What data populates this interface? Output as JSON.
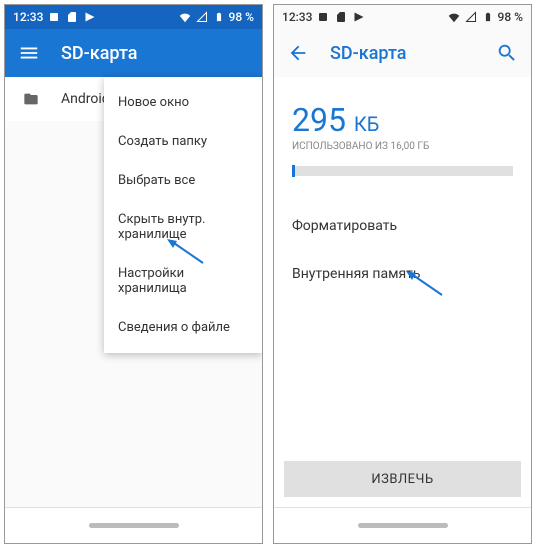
{
  "left": {
    "status": {
      "time": "12:33",
      "battery": "98 %"
    },
    "appbar": {
      "title": "SD-карта"
    },
    "folder": {
      "name": "Android"
    },
    "menu": {
      "items": [
        "Новое окно",
        "Создать папку",
        "Выбрать все",
        "Скрыть внутр. хранилище",
        "Настройки хранилища",
        "Сведения о файле"
      ]
    }
  },
  "right": {
    "status": {
      "time": "12:33",
      "battery": "98 %"
    },
    "appbar": {
      "title": "SD-карта"
    },
    "storage": {
      "value": "295",
      "unit": "КБ",
      "caption": "использовано из 16,00 ГБ"
    },
    "options": {
      "format": "Форматировать",
      "internal": "Внутренняя память"
    },
    "eject": "ИЗВЛЕЧЬ"
  }
}
